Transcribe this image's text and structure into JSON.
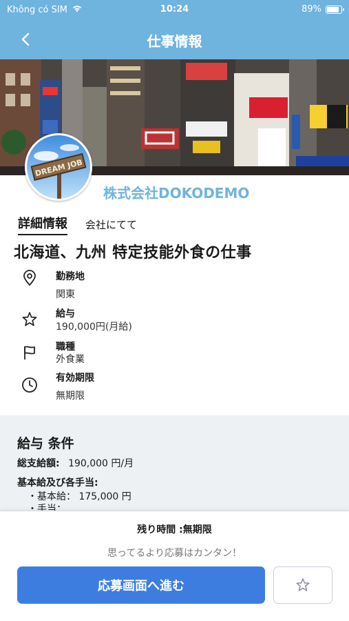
{
  "status_bar": {
    "carrier": "Không có SIM",
    "time": "10:24",
    "battery": "89%",
    "battery_level": 0.89
  },
  "nav": {
    "title": "仕事情報"
  },
  "company": {
    "name": "株式会社DOKODEMO",
    "logo_text": "DREAM JOB"
  },
  "tabs": {
    "active": "詳細情報",
    "other": "会社にてて"
  },
  "job": {
    "title": "北海道、九州 特定技能外食の仕事",
    "details": [
      {
        "icon": "location-pin-icon",
        "label": "勤務地",
        "value": "関東"
      },
      {
        "icon": "star-outline-icon",
        "label": "給与",
        "value": "190,000円(月給)"
      },
      {
        "icon": "flag-icon",
        "label": "職種",
        "value": "外食業"
      },
      {
        "icon": "clock-icon",
        "label": "有効期限",
        "value": "無期限"
      }
    ]
  },
  "conditions": {
    "title": "給与 条件",
    "total_label": "総支給額:",
    "total_value": "190,000 円/月",
    "breakdown_label": "基本給及び各手当:",
    "base_salary": "・基本給： 175,000 円",
    "allowance": "・手当："
  },
  "bottom_sheet": {
    "remaining": "残り時間 :無期限",
    "hint": "思ってるより応募はカンタン！",
    "apply_label": "応募画面へ進む"
  },
  "colors": {
    "header": "#6fb3df",
    "button": "#3d7de0",
    "section_bg": "#eef1f4"
  }
}
